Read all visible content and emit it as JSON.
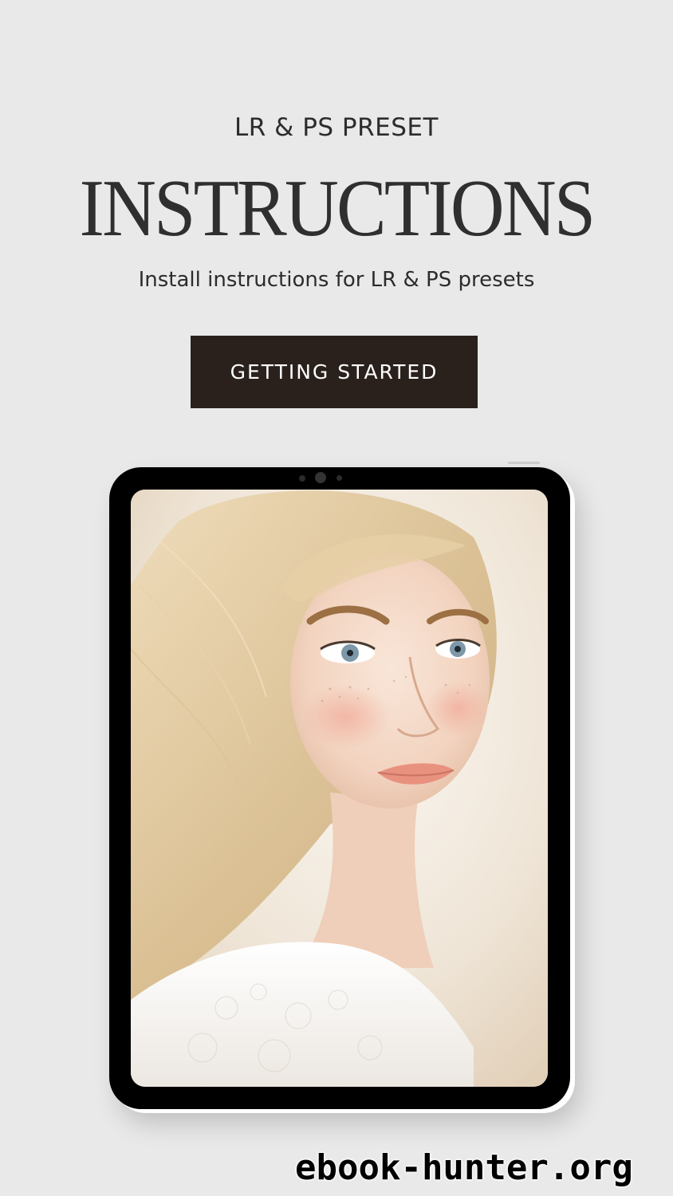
{
  "header": {
    "kicker": "LR & PS PRESET",
    "title": "INSTRUCTIONS",
    "subtitle": "Install instructions for LR & PS presets"
  },
  "cta": {
    "label": "GETTING STARTED"
  },
  "device": {
    "screen_image": "portrait-photo"
  },
  "watermark": {
    "text": "ebook-hunter.org"
  },
  "colors": {
    "background": "#e9e9e9",
    "button": "#2a211c",
    "button_text": "#ffffff",
    "text": "#2c2c2c"
  }
}
